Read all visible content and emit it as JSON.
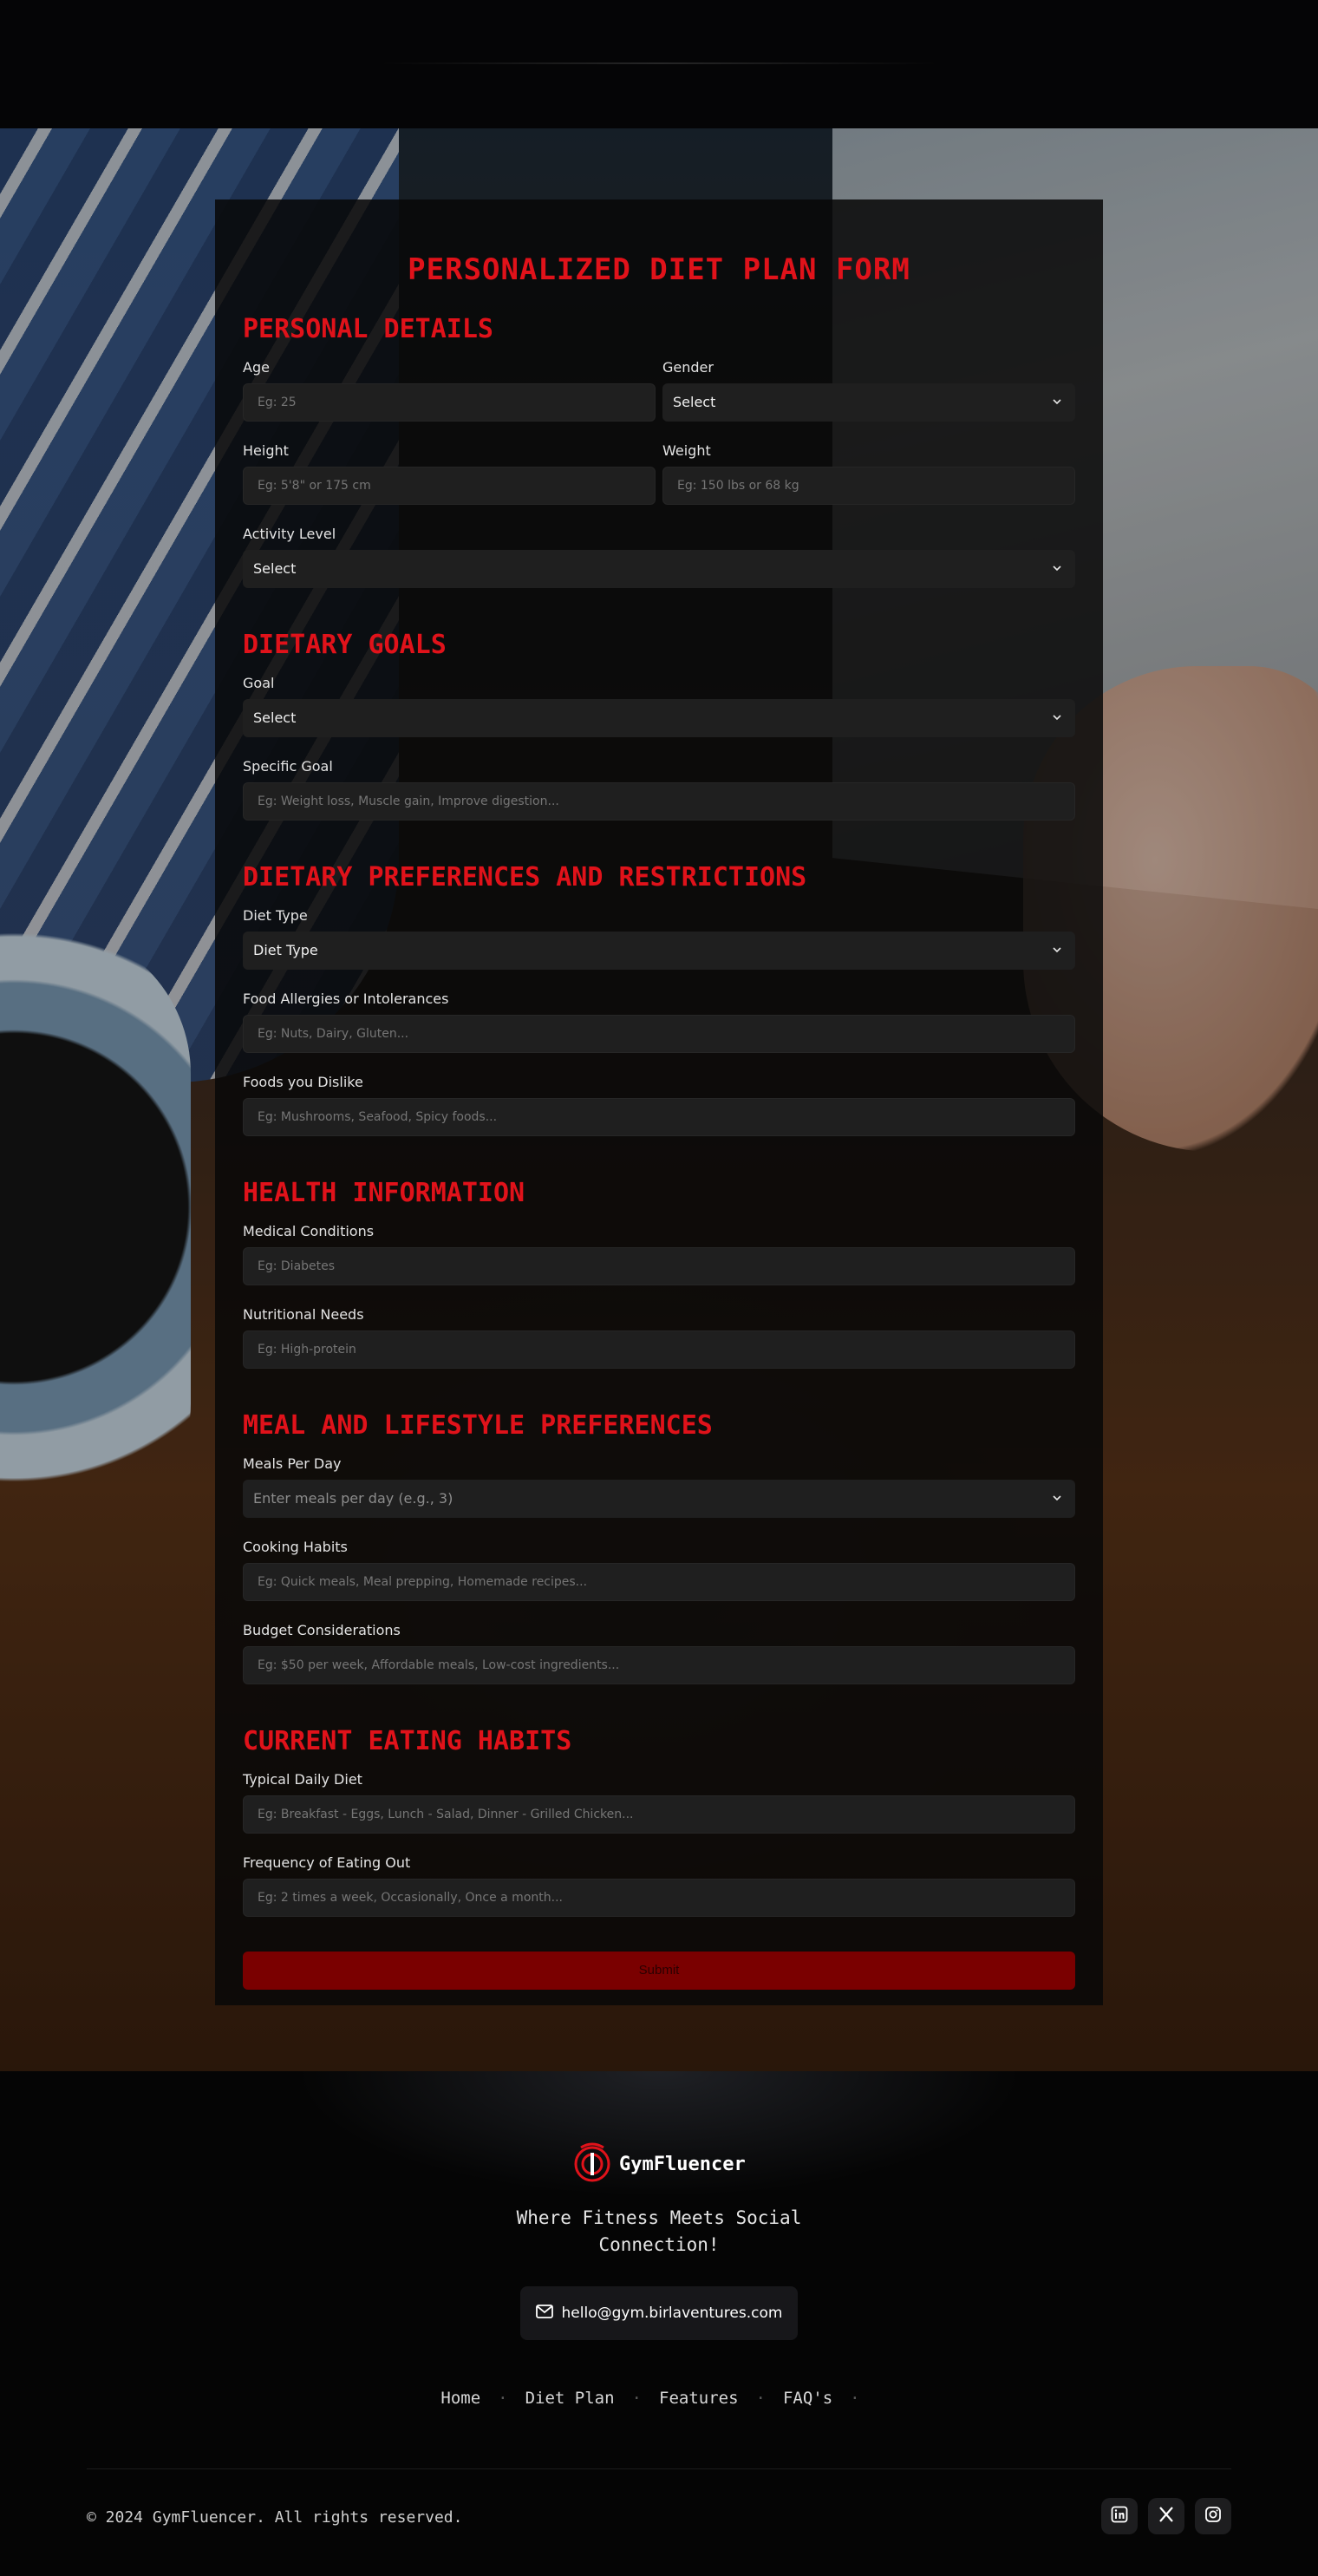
{
  "form": {
    "title": "PERSONALIZED DIET PLAN FORM",
    "submit_label": "Submit",
    "sections": {
      "personal": {
        "title": "PERSONAL DETAILS",
        "age": {
          "label": "Age",
          "placeholder": "Eg: 25"
        },
        "gender": {
          "label": "Gender",
          "value": "Select"
        },
        "height": {
          "label": "Height",
          "placeholder": "Eg: 5'8\" or 175 cm"
        },
        "weight": {
          "label": "Weight",
          "placeholder": "Eg: 150 lbs or 68 kg"
        },
        "activity": {
          "label": "Activity Level",
          "value": "Select"
        }
      },
      "goals": {
        "title": "DIETARY GOALS",
        "goal": {
          "label": "Goal",
          "value": "Select"
        },
        "specific": {
          "label": "Specific Goal",
          "placeholder": "Eg: Weight loss, Muscle gain, Improve digestion..."
        }
      },
      "preferences": {
        "title": "DIETARY PREFERENCES AND RESTRICTIONS",
        "diet_type": {
          "label": "Diet Type",
          "value": "Diet Type"
        },
        "allergies": {
          "label": "Food Allergies or Intolerances",
          "placeholder": "Eg: Nuts, Dairy, Gluten..."
        },
        "dislikes": {
          "label": "Foods you Dislike",
          "placeholder": "Eg: Mushrooms, Seafood, Spicy foods..."
        }
      },
      "health": {
        "title": "HEALTH INFORMATION",
        "conditions": {
          "label": "Medical Conditions",
          "placeholder": "Eg: Diabetes"
        },
        "needs": {
          "label": "Nutritional Needs",
          "placeholder": "Eg: High-protein"
        }
      },
      "meals": {
        "title": "MEAL AND LIFESTYLE PREFERENCES",
        "per_day": {
          "label": "Meals Per Day",
          "value": "Enter meals per day (e.g., 3)"
        },
        "cooking": {
          "label": "Cooking Habits",
          "placeholder": "Eg: Quick meals, Meal prepping, Homemade recipes..."
        },
        "budget": {
          "label": "Budget Considerations",
          "placeholder": "Eg: $50 per week, Affordable meals, Low-cost ingredients..."
        }
      },
      "eating": {
        "title": "CURRENT EATING HABITS",
        "daily": {
          "label": "Typical Daily Diet",
          "placeholder": "Eg: Breakfast - Eggs, Lunch - Salad, Dinner - Grilled Chicken..."
        },
        "eating_out": {
          "label": "Frequency of Eating Out",
          "placeholder": "Eg: 2 times a week, Occasionally, Once a month..."
        }
      }
    }
  },
  "footer": {
    "brand": "GymFluencer",
    "tagline": "Where Fitness Meets Social Connection!",
    "email": "hello@gym.birlaventures.com",
    "nav": [
      "Home",
      "Diet Plan",
      "Features",
      "FAQ's"
    ],
    "copyright": "© 2024 GymFluencer. All rights reserved.",
    "social_icons": [
      "linkedin-icon",
      "x-icon",
      "instagram-icon"
    ]
  },
  "colors": {
    "accent": "#e0121a",
    "submit_bg": "#7a0000",
    "field_bg": "#1f1f1f"
  }
}
